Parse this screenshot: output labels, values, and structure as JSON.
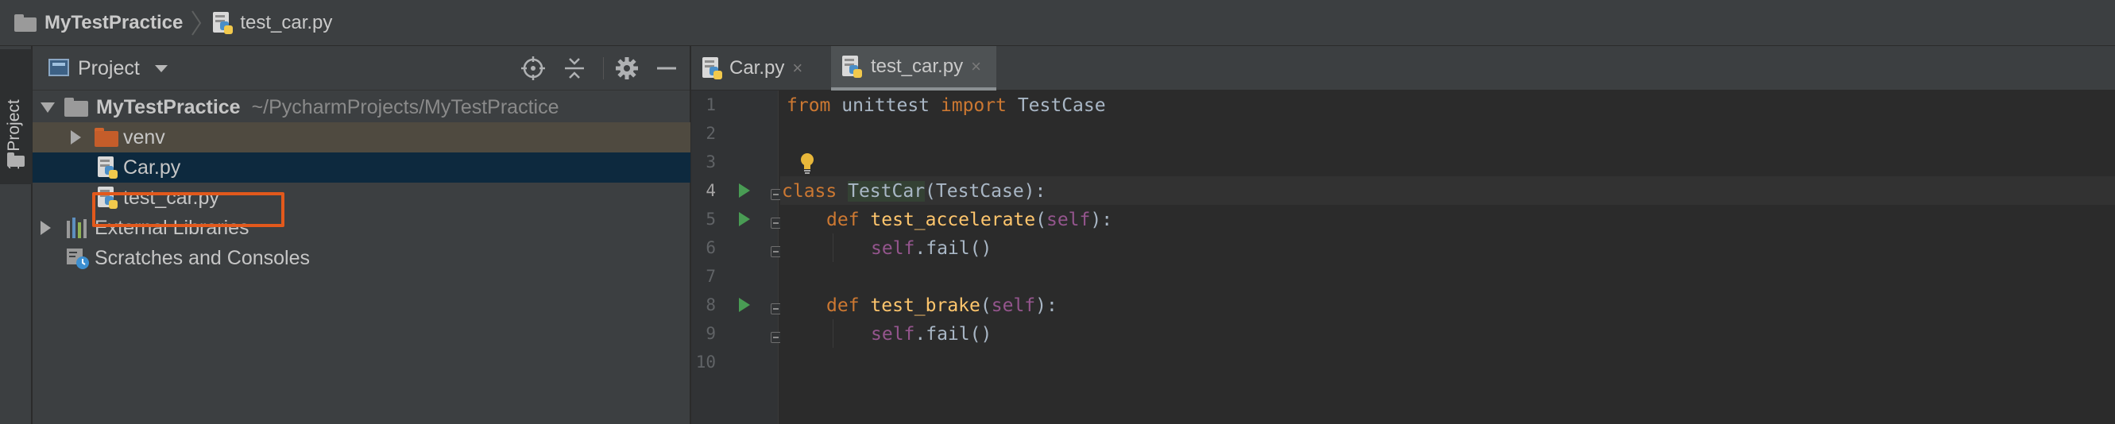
{
  "breadcrumb": {
    "project": "MyTestPractice",
    "file": "test_car.py"
  },
  "toolstrip": {
    "project_tab": "1: Project"
  },
  "project_panel": {
    "title": "Project",
    "tree": [
      {
        "label": "MyTestPractice",
        "path": "~/PycharmProjects/MyTestPractice",
        "type": "folder",
        "expanded": true
      },
      {
        "label": "venv",
        "type": "folder",
        "expanded": false
      },
      {
        "label": "Car.py",
        "type": "python-file",
        "selected": true
      },
      {
        "label": "test_car.py",
        "type": "python-file",
        "highlighted": true
      },
      {
        "label": "External Libraries",
        "type": "libraries",
        "expanded": false
      },
      {
        "label": "Scratches and Consoles",
        "type": "scratches"
      }
    ]
  },
  "editor": {
    "tabs": [
      {
        "label": "Car.py",
        "active": false,
        "close": "×"
      },
      {
        "label": "test_car.py",
        "active": true,
        "close": "×"
      }
    ],
    "line_numbers": [
      "1",
      "2",
      "3",
      "4",
      "5",
      "6",
      "7",
      "8",
      "9",
      "10"
    ],
    "current_line": "4",
    "code": {
      "l1": {
        "kw1": "from",
        "t1": " unittest ",
        "kw2": "import",
        "t2": " TestCase"
      },
      "l4": {
        "kw": "class",
        "name": "TestCar",
        "rest": "(TestCase):"
      },
      "l5": {
        "kw": "def",
        "name": "test_accelerate",
        "p1": "(",
        "self": "self",
        "p2": "):"
      },
      "l6": {
        "self": "self",
        "rest": ".fail()"
      },
      "l8": {
        "kw": "def",
        "name": "test_brake",
        "p1": "(",
        "self": "self",
        "p2": "):"
      },
      "l9": {
        "self": "self",
        "rest": ".fail()"
      }
    }
  },
  "colors": {
    "highlight_border": "#e2591c",
    "selection_bg": "#0d293e",
    "keyword": "#cc7832",
    "function": "#ffc66d",
    "self": "#94558d",
    "run_icon": "#499c54"
  }
}
